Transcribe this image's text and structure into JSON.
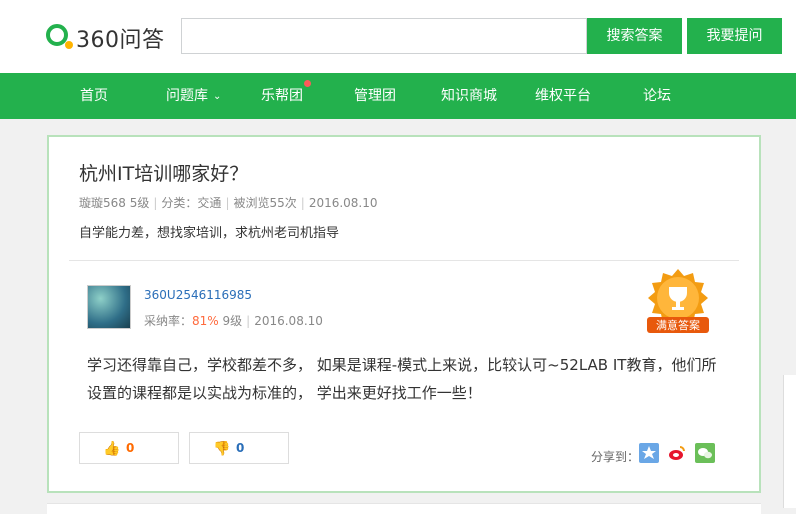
{
  "header": {
    "logo_text": "360问答",
    "search_placeholder": "",
    "search_button": "搜索答案",
    "ask_button": "我要提问"
  },
  "nav": {
    "items": [
      {
        "label": "首页"
      },
      {
        "label": "问题库"
      },
      {
        "label": "乐帮团"
      },
      {
        "label": "管理团"
      },
      {
        "label": "知识商城"
      },
      {
        "label": "维权平台"
      },
      {
        "label": "论坛"
      }
    ]
  },
  "question": {
    "title": "杭州IT培训哪家好？",
    "author": "璇璇568",
    "level": "5级",
    "category": "分类：交通",
    "views": "被浏览55次",
    "date": "2016.08.10",
    "description": "自学能力差，想找家培训，求杭州老司机指导"
  },
  "answer": {
    "user": "360U2546116985",
    "adopt_label": "采纳率：",
    "adopt_rate": "81%",
    "level": "9级",
    "date": "2016.08.10",
    "badge_text": "满意答案",
    "text": "学习还得靠自己，学校都差不多， 如果是课程-模式上来说，比较认可~52LAB IT教育，他们所设置的课程都是以实战为标准的， 学出来更好找工作一些！",
    "upvotes": "0",
    "downvotes": "0",
    "share_label": "分享到："
  },
  "colors": {
    "brand_green": "#23b14d",
    "upvote": "#ff6a00",
    "downvote": "#2a6eb8",
    "badge_orange": "#f39c12"
  }
}
